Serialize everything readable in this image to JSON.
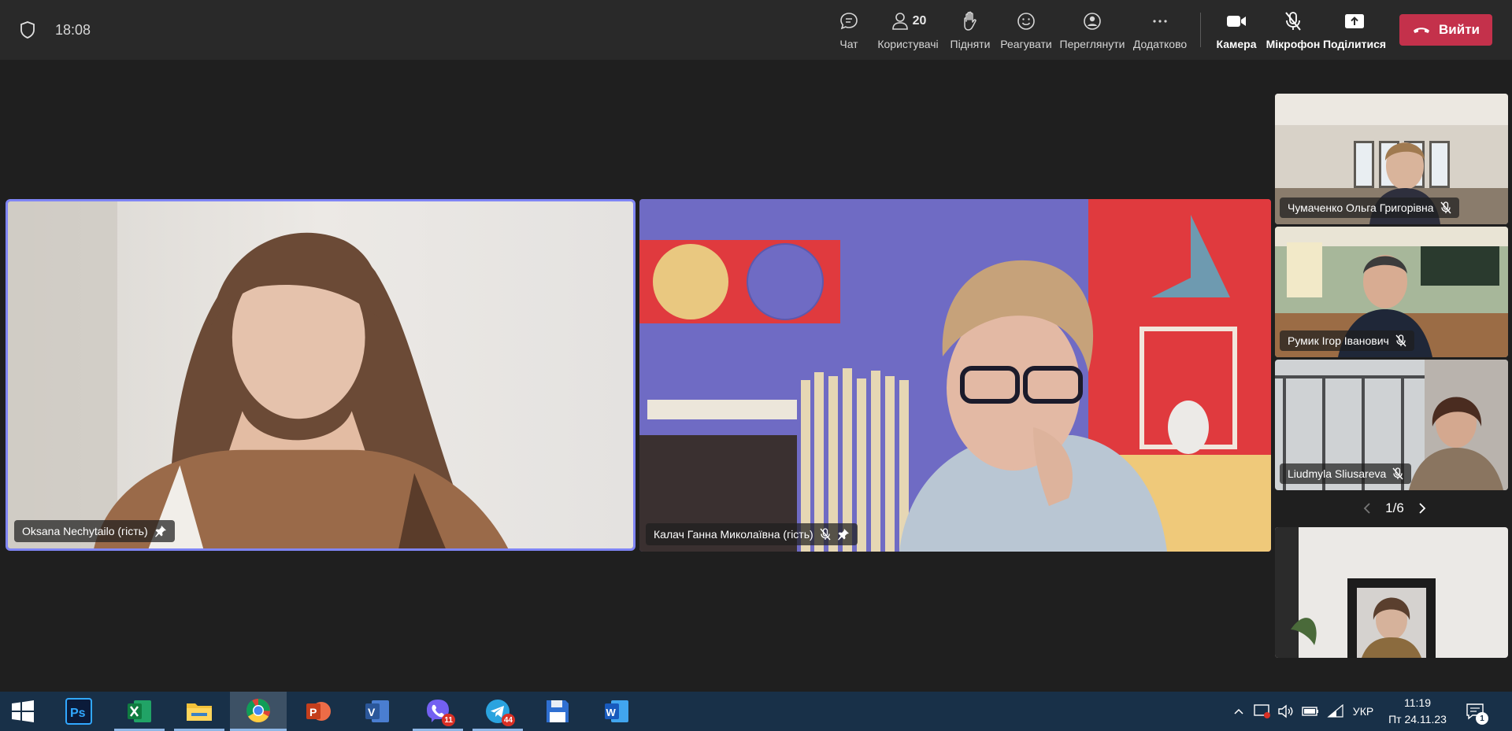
{
  "header": {
    "clock": "18:08",
    "participants_count": "20",
    "actions": [
      {
        "label": "Чат",
        "icon": "chat-icon"
      },
      {
        "label": "Користувачі",
        "icon": "people-icon"
      },
      {
        "label": "Підняти",
        "icon": "raise-hand-icon"
      },
      {
        "label": "Реагувати",
        "icon": "react-icon"
      },
      {
        "label": "Переглянути",
        "icon": "view-icon"
      },
      {
        "label": "Додатково",
        "icon": "more-icon"
      }
    ],
    "device_controls": [
      {
        "label": "Камера",
        "icon": "camera-icon"
      },
      {
        "label": "Мікрофон",
        "icon": "mic-off-icon"
      },
      {
        "label": "Поділитися",
        "icon": "share-icon"
      }
    ],
    "leave_label": "Вийти",
    "leave_color": "#c4314b"
  },
  "stage": {
    "tiles": [
      {
        "name": "Oksana Nechytailo (гість)",
        "pinned": true,
        "muted": false,
        "active_speaker": true
      },
      {
        "name": "Калач Ганна Миколаївна (гість)",
        "pinned": true,
        "muted": true,
        "active_speaker": false
      }
    ]
  },
  "gallery": {
    "tiles": [
      {
        "name": "Чумаченко Ольга Григорівна",
        "muted": true
      },
      {
        "name": "Румик Ігор Іванович",
        "muted": true
      },
      {
        "name": "Liudmyla Sliusareva",
        "muted": true
      },
      {
        "name": "",
        "muted": false
      }
    ],
    "page": "1/6"
  },
  "taskbar": {
    "apps": [
      {
        "name": "start-button",
        "icon": "windows-icon"
      },
      {
        "name": "photoshop",
        "icon": "photoshop-icon"
      },
      {
        "name": "excel",
        "icon": "excel-icon"
      },
      {
        "name": "file-explorer",
        "icon": "folder-icon"
      },
      {
        "name": "chrome",
        "icon": "chrome-icon"
      },
      {
        "name": "powerpoint",
        "icon": "powerpoint-icon"
      },
      {
        "name": "visio",
        "icon": "visio-icon"
      },
      {
        "name": "viber",
        "icon": "viber-icon",
        "badge": "11"
      },
      {
        "name": "telegram",
        "icon": "telegram-icon",
        "badge": "44"
      },
      {
        "name": "save-app",
        "icon": "floppy-icon"
      },
      {
        "name": "word",
        "icon": "word-icon"
      }
    ],
    "tray": {
      "language": "УКР",
      "time": "11:19",
      "date": "Пт 24.11.23",
      "notifications": "1"
    }
  }
}
